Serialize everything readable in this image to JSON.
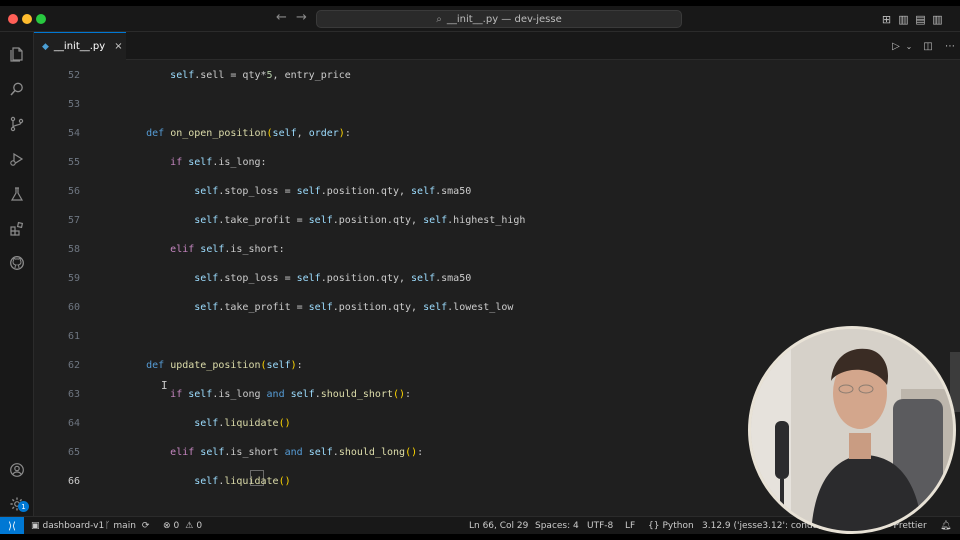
{
  "titlebar": {
    "search_text": "__init__.py — dev-jesse",
    "back_icon": "arrow-left-icon",
    "forward_icon": "arrow-right-icon"
  },
  "tab": {
    "label": "__init__.py",
    "icon": "python-file-icon"
  },
  "editor": {
    "lines": [
      {
        "n": "52",
        "tokens": [
          [
            "        ",
            ""
          ],
          [
            "self",
            "self"
          ],
          [
            ".sell = qty*",
            ""
          ],
          [
            "5",
            "num"
          ],
          [
            ", entry_price",
            ""
          ]
        ]
      },
      {
        "n": "53",
        "tokens": []
      },
      {
        "n": "54",
        "tokens": [
          [
            "    ",
            ""
          ],
          [
            "def",
            "kw"
          ],
          [
            " ",
            ""
          ],
          [
            "on_open_position",
            "fn"
          ],
          [
            "(",
            "paren"
          ],
          [
            "self",
            "self"
          ],
          [
            ", ",
            ""
          ],
          [
            "order",
            "param"
          ],
          [
            ")",
            "paren"
          ],
          [
            ":",
            ""
          ]
        ]
      },
      {
        "n": "55",
        "tokens": [
          [
            "        ",
            ""
          ],
          [
            "if",
            "kw2"
          ],
          [
            " ",
            ""
          ],
          [
            "self",
            "self"
          ],
          [
            ".is_long:",
            ""
          ]
        ]
      },
      {
        "n": "56",
        "tokens": [
          [
            "            ",
            ""
          ],
          [
            "self",
            "self"
          ],
          [
            ".stop_loss = ",
            ""
          ],
          [
            "self",
            "self"
          ],
          [
            ".position.qty, ",
            ""
          ],
          [
            "self",
            "self"
          ],
          [
            ".sma50",
            ""
          ]
        ]
      },
      {
        "n": "57",
        "tokens": [
          [
            "            ",
            ""
          ],
          [
            "self",
            "self"
          ],
          [
            ".take_profit = ",
            ""
          ],
          [
            "self",
            "self"
          ],
          [
            ".position.qty, ",
            ""
          ],
          [
            "self",
            "self"
          ],
          [
            ".highest_high",
            ""
          ]
        ]
      },
      {
        "n": "58",
        "tokens": [
          [
            "        ",
            ""
          ],
          [
            "elif",
            "kw2"
          ],
          [
            " ",
            ""
          ],
          [
            "self",
            "self"
          ],
          [
            ".is_short:",
            ""
          ]
        ]
      },
      {
        "n": "59",
        "tokens": [
          [
            "            ",
            ""
          ],
          [
            "self",
            "self"
          ],
          [
            ".stop_loss = ",
            ""
          ],
          [
            "self",
            "self"
          ],
          [
            ".position.qty, ",
            ""
          ],
          [
            "self",
            "self"
          ],
          [
            ".sma50",
            ""
          ]
        ]
      },
      {
        "n": "60",
        "tokens": [
          [
            "            ",
            ""
          ],
          [
            "self",
            "self"
          ],
          [
            ".take_profit = ",
            ""
          ],
          [
            "self",
            "self"
          ],
          [
            ".position.qty, ",
            ""
          ],
          [
            "self",
            "self"
          ],
          [
            ".lowest_low",
            ""
          ]
        ]
      },
      {
        "n": "61",
        "tokens": []
      },
      {
        "n": "62",
        "tokens": [
          [
            "    ",
            ""
          ],
          [
            "def",
            "kw"
          ],
          [
            " ",
            ""
          ],
          [
            "update_position",
            "fn"
          ],
          [
            "(",
            "paren"
          ],
          [
            "self",
            "self"
          ],
          [
            ")",
            "paren"
          ],
          [
            ":",
            ""
          ]
        ]
      },
      {
        "n": "63",
        "tokens": [
          [
            "        ",
            ""
          ],
          [
            "if",
            "kw2"
          ],
          [
            " ",
            ""
          ],
          [
            "self",
            "self"
          ],
          [
            ".is_long ",
            ""
          ],
          [
            "and",
            "kw"
          ],
          [
            " ",
            ""
          ],
          [
            "self",
            "self"
          ],
          [
            ".",
            ""
          ],
          [
            "should_short",
            "fn"
          ],
          [
            "()",
            "paren"
          ],
          [
            ":",
            ""
          ]
        ]
      },
      {
        "n": "64",
        "tokens": [
          [
            "            ",
            ""
          ],
          [
            "self",
            "self"
          ],
          [
            ".",
            ""
          ],
          [
            "liquidate",
            "fn"
          ],
          [
            "()",
            "paren"
          ]
        ]
      },
      {
        "n": "65",
        "tokens": [
          [
            "        ",
            ""
          ],
          [
            "elif",
            "kw2"
          ],
          [
            " ",
            ""
          ],
          [
            "self",
            "self"
          ],
          [
            ".is_short ",
            ""
          ],
          [
            "and",
            "kw"
          ],
          [
            " ",
            ""
          ],
          [
            "self",
            "self"
          ],
          [
            ".",
            ""
          ],
          [
            "should_long",
            "fn"
          ],
          [
            "()",
            "paren"
          ],
          [
            ":",
            ""
          ]
        ]
      },
      {
        "n": "66",
        "tokens": [
          [
            "            ",
            ""
          ],
          [
            "self",
            "self"
          ],
          [
            ".",
            ""
          ],
          [
            "liquidate",
            "fn"
          ],
          [
            "()",
            "paren"
          ]
        ]
      }
    ],
    "current_line": "66"
  },
  "statusbar": {
    "branch_folder": "dashboard-v1",
    "git_branch": "main",
    "errors": "0",
    "warnings": "0",
    "position": "Ln 66, Col 29",
    "spaces": "Spaces: 4",
    "encoding": "UTF-8",
    "eol": "LF",
    "language": "Python",
    "interpreter": "3.12.9 ('jesse3.12': conda)",
    "formatter": "Prettier",
    "notification_count": "1"
  },
  "colors": {
    "accent": "#0078d4",
    "editor_bg": "#1f1f1f",
    "chrome_bg": "#181818"
  }
}
